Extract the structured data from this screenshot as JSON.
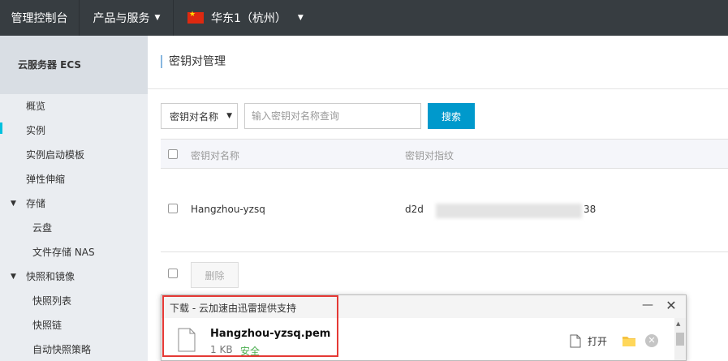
{
  "topbar": {
    "home_label": "管理控制台",
    "products_label": "产品与服务",
    "region_label": "华东1（杭州）"
  },
  "sidebar": {
    "title": "云服务器 ECS",
    "items": [
      {
        "label": "概览"
      },
      {
        "label": "实例"
      },
      {
        "label": "实例启动模板"
      },
      {
        "label": "弹性伸缩"
      },
      {
        "label": "存储"
      },
      {
        "label": "云盘"
      },
      {
        "label": "文件存储 NAS"
      },
      {
        "label": "快照和镜像"
      },
      {
        "label": "快照列表"
      },
      {
        "label": "快照链"
      },
      {
        "label": "自动快照策略"
      }
    ]
  },
  "main": {
    "title": "密钥对管理",
    "search": {
      "select_value": "密钥对名称",
      "placeholder": "输入密钥对名称查询",
      "button_label": "搜索"
    },
    "table": {
      "columns": [
        "密钥对名称",
        "密钥对指纹"
      ],
      "rows": [
        {
          "name": "Hangzhou-yzsq",
          "fingerprint_start": "d2d",
          "fingerprint_end": "38"
        }
      ],
      "delete_label": "删除"
    }
  },
  "download": {
    "title": "下载 - 云加速由迅雷提供支持",
    "filename": "Hangzhou-yzsq.pem",
    "size": "1 KB",
    "safety": "安全",
    "open_label": "打开"
  },
  "colors": {
    "topbar_bg": "#373d41",
    "accent": "#0099cc",
    "highlight": "#e53935",
    "safe": "#4caf50"
  }
}
